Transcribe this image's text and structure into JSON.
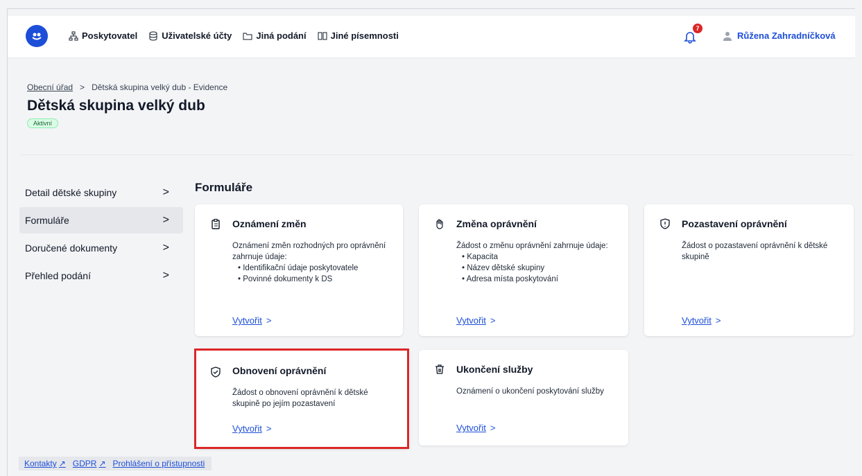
{
  "header": {
    "logo_text": "⛯",
    "nav": [
      {
        "label": "Poskytovatel",
        "icon": "org-chart-icon"
      },
      {
        "label": "Uživatelské účty",
        "icon": "database-icon"
      },
      {
        "label": "Jiná podání",
        "icon": "folder-icon"
      },
      {
        "label": "Jiné písemnosti",
        "icon": "book-icon"
      }
    ],
    "notification_count": "7",
    "user_name": "Růžena Zahradníčková"
  },
  "breadcrumb": {
    "root": "Obecní úřad",
    "separator": ">",
    "current": "Dětská skupina velký dub - Evidence"
  },
  "page": {
    "title": "Dětská skupina velký dub",
    "status": "Aktivní"
  },
  "sidebar": {
    "items": [
      {
        "label": "Detail dětské skupiny"
      },
      {
        "label": "Formuláře"
      },
      {
        "label": "Doručené dokumenty"
      },
      {
        "label": "Přehled podání"
      }
    ],
    "chevron": ">"
  },
  "main": {
    "section_title": "Formuláře",
    "cards": [
      {
        "title": "Oznámení změn",
        "desc": "Oznámení změn rozhodných pro oprávnění zahrnuje údaje:",
        "bullets": [
          "Identifikační údaje poskytovatele",
          "Povinné dokumenty k DS"
        ],
        "link": "Vytvořit"
      },
      {
        "title": "Změna oprávnění",
        "desc": "Žádost o změnu oprávnění zahrnuje údaje:",
        "bullets": [
          "Kapacita",
          "Název dětské skupiny",
          "Adresa místa poskytování"
        ],
        "link": "Vytvořit"
      },
      {
        "title": "Pozastavení oprávnění",
        "desc": "Žádost o pozastavení oprávnění k dětské skupině",
        "link": "Vytvořit"
      },
      {
        "title": "Obnovení oprávnění",
        "desc": "Žádost o obnovení oprávnění k dětské skupině po jejím pozastavení",
        "link": "Vytvořit"
      },
      {
        "title": "Ukončení služby",
        "desc": "Oznámení o ukončení poskytování služby",
        "link": "Vytvořit"
      }
    ],
    "link_chevron": ">"
  },
  "footer": {
    "links": [
      "Kontakty",
      "GDPR",
      "Prohlášení o přístupnosti"
    ]
  },
  "colors": {
    "accent": "#1d4ed8",
    "highlight": "#dc2626",
    "status_bg": "#dcfce7"
  }
}
